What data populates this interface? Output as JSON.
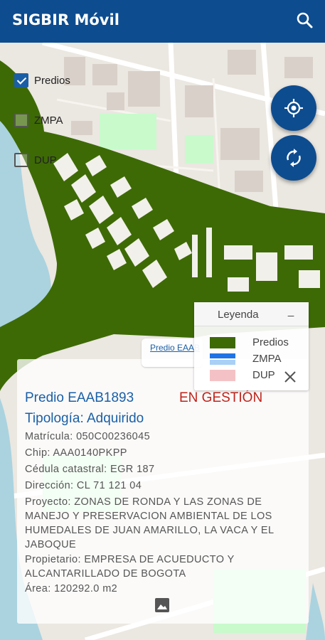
{
  "app": {
    "title": "SIGBIR Móvil"
  },
  "layers": [
    {
      "label": "Predios",
      "checked": true
    },
    {
      "label": "ZMPA",
      "checked": false
    },
    {
      "label": "DUP",
      "checked": false
    }
  ],
  "legend": {
    "title": "Leyenda",
    "minimize": "_",
    "items": [
      {
        "label": "Predios",
        "color": "#3d6a05"
      },
      {
        "label": "ZMPA",
        "color": "#1e74e6"
      },
      {
        "label": "DUP",
        "color": "#f4c2c6"
      }
    ]
  },
  "map_chip": {
    "label": "Predio EAAB1893"
  },
  "info": {
    "predio": "Predio EAAB1893",
    "status": "EN GESTIÓN",
    "tipologia": "Tipología: Adquirido",
    "matricula": "Matrícula: 050C00236045",
    "chip": "Chip: AAA0140PKPP",
    "cedula": "Cédula catastral: EGR 187",
    "direccion": "Dirección: CL 71 121 04",
    "proyecto_1": "Proyecto: ZONAS DE RONDA Y LAS ZONAS DE",
    "proyecto_2": "MANEJO Y PRESERVACION AMBIENTAL DE LOS",
    "proyecto_3": "HUMEDALES DE JUAN AMARILLO, LA VACA Y EL",
    "proyecto_4": "JABOQUE",
    "propietario_1": "Propietario: EMPRESA DE ACUEDUCTO Y",
    "propietario_2": "ALCANTARILLADO DE BOGOTA",
    "area": "Área: 120292.0 m2"
  },
  "colors": {
    "primary": "#0d4c8f",
    "parcel": "#3d6a05",
    "status": "#c0221a",
    "link": "#1a5fa6",
    "water": "#aad3df",
    "park": "#c8facc"
  },
  "icons": [
    "search-icon",
    "my-location-icon",
    "sync-icon",
    "close-icon",
    "image-icon"
  ]
}
